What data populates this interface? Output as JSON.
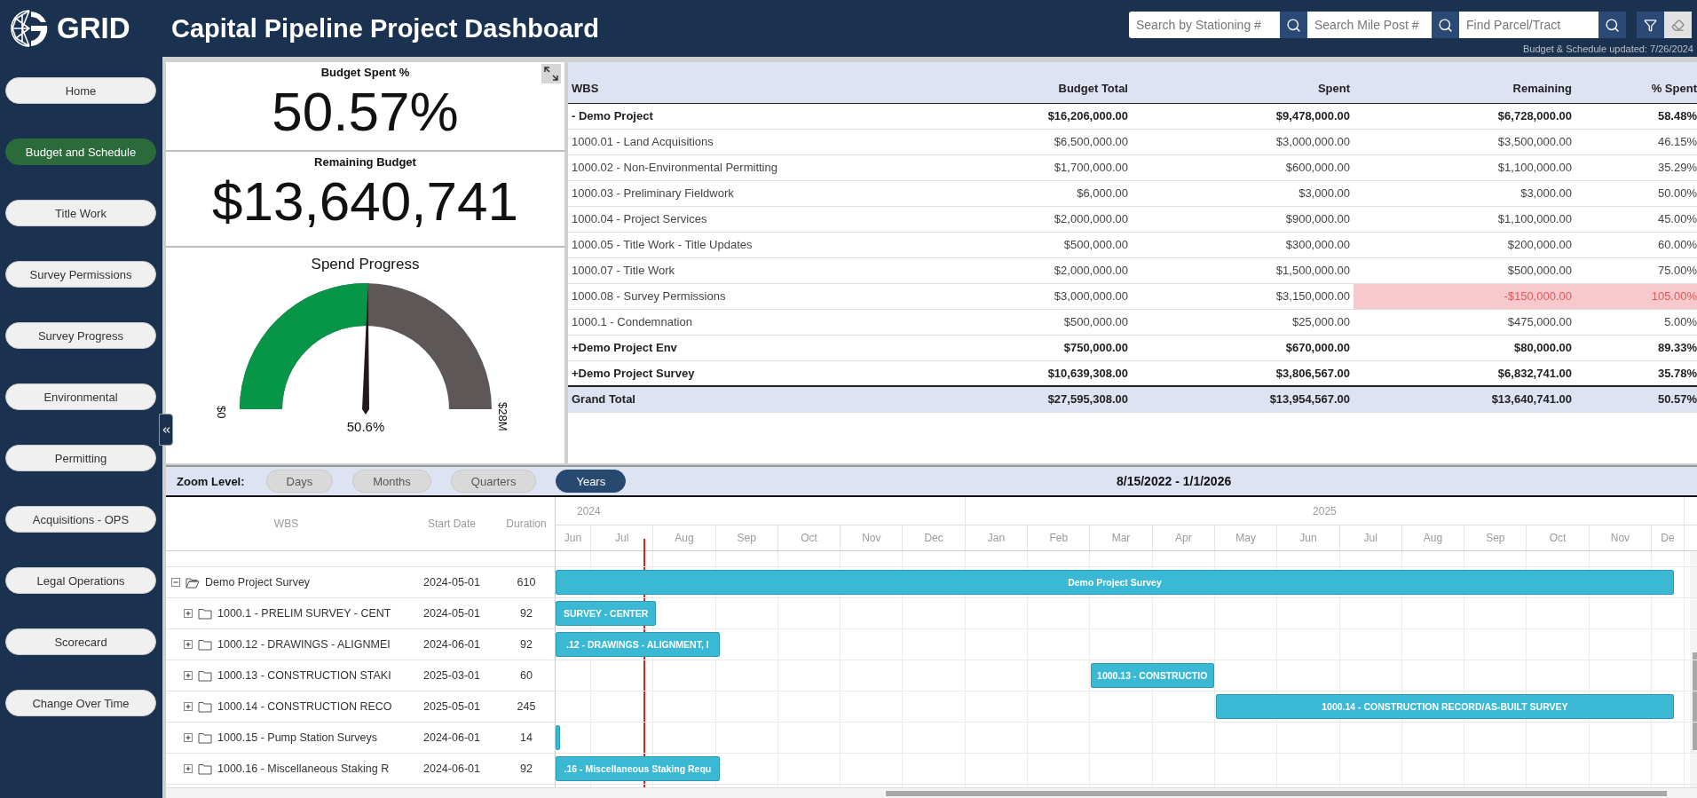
{
  "header": {
    "logo_text": "GRID",
    "title": "Capital Pipeline Project Dashboard",
    "searches": [
      {
        "placeholder": "Search by Stationing #"
      },
      {
        "placeholder": "Search Mile Post #"
      },
      {
        "placeholder": "Find Parcel/Tract"
      }
    ],
    "updated": "Budget & Schedule updated: 7/26/2024"
  },
  "sidebar": {
    "items": [
      {
        "label": "Home",
        "selected": false
      },
      {
        "label": "Budget and Schedule",
        "selected": true
      },
      {
        "label": "Title Work",
        "selected": false
      },
      {
        "label": "Survey Permissions",
        "selected": false
      },
      {
        "label": "Survey Progress",
        "selected": false
      },
      {
        "label": "Environmental",
        "selected": false
      },
      {
        "label": "Permitting",
        "selected": false
      },
      {
        "label": "Acquisitions - OPS",
        "selected": false
      },
      {
        "label": "Legal Operations",
        "selected": false
      },
      {
        "label": "Scorecard",
        "selected": false
      },
      {
        "label": "Change Over Time",
        "selected": false
      }
    ]
  },
  "kpis": [
    {
      "title": "Budget Spent %",
      "value": "50.57%"
    },
    {
      "title": "Remaining Budget",
      "value": "$13,640,741"
    }
  ],
  "gauge": {
    "title": "Spend Progress",
    "level": 0.506,
    "min_label": "$0",
    "max_label": "$28M",
    "reading": "50.6%"
  },
  "wbs_table": {
    "columns": [
      "WBS",
      "Budget Total",
      "Spent",
      "Remaining",
      "% Spent"
    ],
    "rows": [
      {
        "kind": "group",
        "toggle": "-",
        "over": false,
        "cells": [
          "Demo Project",
          "$16,206,000.00",
          "$9,478,000.00",
          "$6,728,000.00",
          "58.48%"
        ]
      },
      {
        "kind": "item",
        "over": false,
        "cells": [
          "1000.01 - Land Acquisitions",
          "$6,500,000.00",
          "$3,000,000.00",
          "$3,500,000.00",
          "46.15%"
        ]
      },
      {
        "kind": "item",
        "over": false,
        "cells": [
          "1000.02 - Non-Environmental Permitting",
          "$1,700,000.00",
          "$600,000.00",
          "$1,100,000.00",
          "35.29%"
        ]
      },
      {
        "kind": "item",
        "over": false,
        "cells": [
          "1000.03 - Preliminary Fieldwork",
          "$6,000.00",
          "$3,000.00",
          "$3,000.00",
          "50.00%"
        ]
      },
      {
        "kind": "item",
        "over": false,
        "cells": [
          "1000.04 - Project Services",
          "$2,000,000.00",
          "$900,000.00",
          "$1,100,000.00",
          "45.00%"
        ]
      },
      {
        "kind": "item",
        "over": false,
        "cells": [
          "1000.05 - Title Work - Title Updates",
          "$500,000.00",
          "$300,000.00",
          "$200,000.00",
          "60.00%"
        ]
      },
      {
        "kind": "item",
        "over": false,
        "cells": [
          "1000.07 - Title Work",
          "$2,000,000.00",
          "$1,500,000.00",
          "$500,000.00",
          "75.00%"
        ]
      },
      {
        "kind": "item",
        "over": true,
        "cells": [
          "1000.08 - Survey Permissions",
          "$3,000,000.00",
          "$3,150,000.00",
          "-$150,000.00",
          "105.00%"
        ]
      },
      {
        "kind": "item",
        "over": false,
        "cells": [
          "1000.1 - Condemnation",
          "$500,000.00",
          "$25,000.00",
          "$475,000.00",
          "5.00%"
        ]
      },
      {
        "kind": "group",
        "toggle": "+",
        "over": false,
        "cells": [
          "Demo Project Env",
          "$750,000.00",
          "$670,000.00",
          "$80,000.00",
          "89.33%"
        ]
      },
      {
        "kind": "group",
        "toggle": "+",
        "over": false,
        "cells": [
          "Demo Project Survey",
          "$10,639,308.00",
          "$3,806,567.00",
          "$6,832,741.00",
          "35.78%"
        ]
      },
      {
        "kind": "total",
        "over": false,
        "cells": [
          "Grand Total",
          "$27,595,308.00",
          "$13,954,567.00",
          "$13,640,741.00",
          "50.57%"
        ]
      }
    ]
  },
  "gantt": {
    "zoom_label": "Zoom Level:",
    "zoom_levels": [
      {
        "label": "Days",
        "selected": false
      },
      {
        "label": "Months",
        "selected": false
      },
      {
        "label": "Quarters",
        "selected": false
      },
      {
        "label": "Years",
        "selected": true
      }
    ],
    "date_range": "8/15/2022 - 1/1/2026",
    "columns": [
      "WBS",
      "Start Date",
      "Duration"
    ],
    "years": [
      "2024",
      "2025"
    ],
    "months": [
      "Jun",
      "Jul",
      "Aug",
      "Sep",
      "Oct",
      "Nov",
      "Dec",
      "Jan",
      "Feb",
      "Mar",
      "Apr",
      "May",
      "Jun",
      "Jul",
      "Aug",
      "Sep",
      "Oct",
      "Nov",
      "De"
    ],
    "rows": [
      {
        "name": "Demo Project Survey",
        "start": "2024-05-01",
        "duration": "610",
        "expanded": true,
        "bar_label": "Demo Project Survey",
        "children": [
          {
            "name": "1000.1 - PRELIM SURVEY - CENT",
            "start": "2024-05-01",
            "duration": "92",
            "expanded": false,
            "bar_label": "SURVEY - CENTER"
          },
          {
            "name": "1000.12 - DRAWINGS - ALIGNMEI",
            "start": "2024-06-01",
            "duration": "92",
            "expanded": false,
            "bar_label": ".12 - DRAWINGS - ALIGNMENT, I"
          },
          {
            "name": "1000.13 - CONSTRUCTION STAKI",
            "start": "2025-03-01",
            "duration": "60",
            "expanded": false,
            "bar_label": "1000.13 - CONSTRUCTIO"
          },
          {
            "name": "1000.14 - CONSTRUCTION RECO",
            "start": "2025-05-01",
            "duration": "245",
            "expanded": false,
            "bar_label": "1000.14 - CONSTRUCTION RECORD/AS-BUILT SURVEY"
          },
          {
            "name": "1000.15 - Pump Station Surveys",
            "start": "2024-06-01",
            "duration": "14",
            "expanded": false
          },
          {
            "name": "1000.16 - Miscellaneous Staking R",
            "start": "2024-06-01",
            "duration": "92",
            "expanded": false,
            "bar_label": ".16 - Miscellaneous Staking Requ"
          }
        ]
      }
    ]
  }
}
